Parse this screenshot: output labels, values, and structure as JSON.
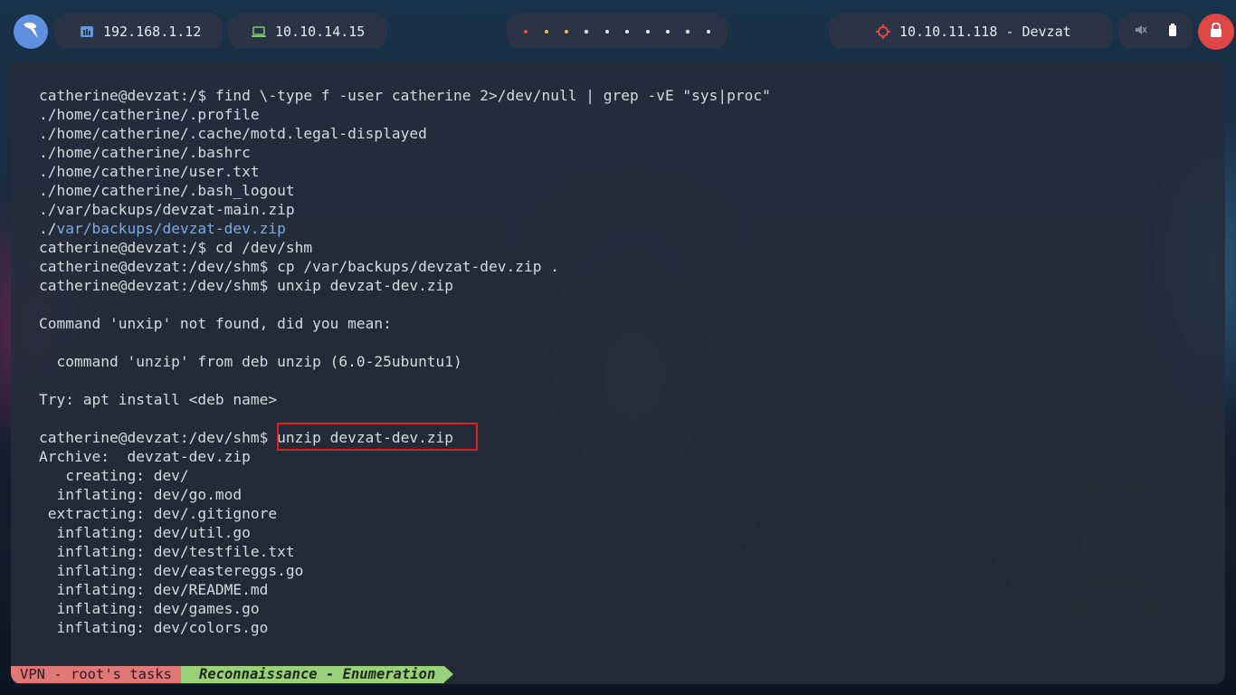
{
  "topbar": {
    "logo_icon": "kali-dragon-icon",
    "local_ip": "192.168.1.12",
    "vpn_ip": "10.10.14.15",
    "target": "10.10.11.118 - Devzat",
    "workspace_dot_colors": [
      "#e05050",
      "#f0c040",
      "#f0c040",
      "#e8e8e8",
      "#e8e8e8",
      "#e8e8e8",
      "#e8e8e8",
      "#e8e8e8",
      "#e8e8e8",
      "#e8e8e8"
    ],
    "accent": "#e04848"
  },
  "terminal": {
    "lines": [
      {
        "text": "catherine@devzat:/$ find \\-type f -user catherine 2>/dev/null | grep -vE \"sys|proc\""
      },
      {
        "text": "./home/catherine/.profile"
      },
      {
        "text": "./home/catherine/.cache/motd.legal-displayed"
      },
      {
        "text": "./home/catherine/.bashrc"
      },
      {
        "text": "./home/catherine/user.txt"
      },
      {
        "text": "./home/catherine/.bash_logout"
      },
      {
        "text": "./var/backups/devzat-main.zip"
      },
      {
        "prefix": "./",
        "highlight": "var/backups/devzat-dev.zip"
      },
      {
        "text": "catherine@devzat:/$ cd /dev/shm"
      },
      {
        "text": "catherine@devzat:/dev/shm$ cp /var/backups/devzat-dev.zip ."
      },
      {
        "text": "catherine@devzat:/dev/shm$ unxip devzat-dev.zip"
      },
      {
        "text": ""
      },
      {
        "text": "Command 'unxip' not found, did you mean:"
      },
      {
        "text": ""
      },
      {
        "text": "  command 'unzip' from deb unzip (6.0-25ubuntu1)"
      },
      {
        "text": ""
      },
      {
        "text": "Try: apt install <deb name>"
      },
      {
        "text": ""
      },
      {
        "text": "catherine@devzat:/dev/shm$ unzip devzat-dev.zip"
      },
      {
        "text": "Archive:  devzat-dev.zip"
      },
      {
        "text": "   creating: dev/"
      },
      {
        "text": "  inflating: dev/go.mod"
      },
      {
        "text": " extracting: dev/.gitignore"
      },
      {
        "text": "  inflating: dev/util.go"
      },
      {
        "text": "  inflating: dev/testfile.txt"
      },
      {
        "text": "  inflating: dev/eastereggs.go"
      },
      {
        "text": "  inflating: dev/README.md"
      },
      {
        "text": "  inflating: dev/games.go"
      },
      {
        "text": "  inflating: dev/colors.go"
      }
    ],
    "highlighted_command": "unzip devzat-dev.zip",
    "highlight_color": "#e02020"
  },
  "statusline": {
    "session": "VPN - root's tasks",
    "window": "Reconnaissance - Enumeration",
    "session_color": "#e07878",
    "window_color": "#9bd07a"
  }
}
